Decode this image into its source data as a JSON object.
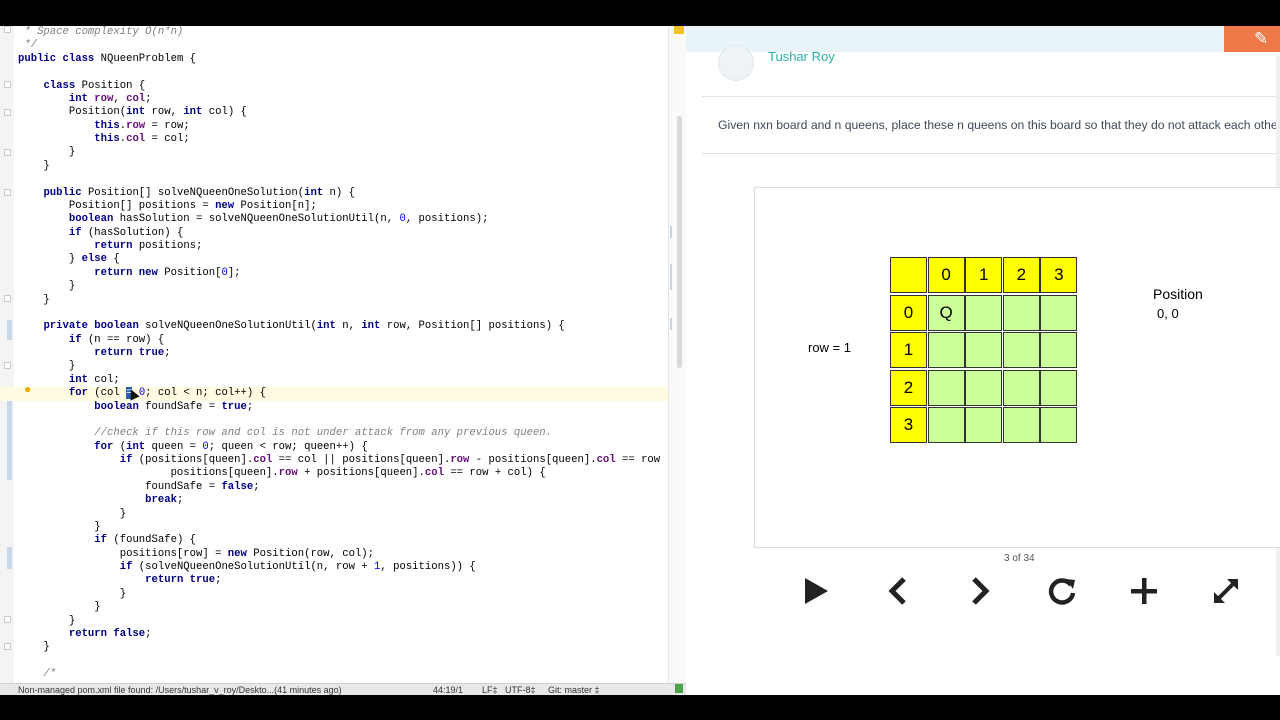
{
  "editor": {
    "lines": [
      [
        {
          "t": " * Space complexity O(n*n)",
          "c": "cmt"
        }
      ],
      [
        {
          "t": " */",
          "c": "cmt"
        }
      ],
      [
        {
          "t": "public class ",
          "c": "kw"
        },
        {
          "t": "NQueenProblem {"
        }
      ],
      [
        {
          "t": ""
        }
      ],
      [
        {
          "t": "    "
        },
        {
          "t": "class ",
          "c": "kw"
        },
        {
          "t": "Position {"
        }
      ],
      [
        {
          "t": "        "
        },
        {
          "t": "int ",
          "c": "kw"
        },
        {
          "t": "row",
          "c": "fld"
        },
        {
          "t": ", "
        },
        {
          "t": "col",
          "c": "fld"
        },
        {
          "t": ";"
        }
      ],
      [
        {
          "t": "        Position("
        },
        {
          "t": "int ",
          "c": "kw"
        },
        {
          "t": "row, "
        },
        {
          "t": "int ",
          "c": "kw"
        },
        {
          "t": "col) {"
        }
      ],
      [
        {
          "t": "            "
        },
        {
          "t": "this",
          "c": "kw"
        },
        {
          "t": "."
        },
        {
          "t": "row",
          "c": "fld"
        },
        {
          "t": " = row;"
        }
      ],
      [
        {
          "t": "            "
        },
        {
          "t": "this",
          "c": "kw"
        },
        {
          "t": "."
        },
        {
          "t": "col",
          "c": "fld"
        },
        {
          "t": " = col;"
        }
      ],
      [
        {
          "t": "        }"
        }
      ],
      [
        {
          "t": "    }"
        }
      ],
      [
        {
          "t": ""
        }
      ],
      [
        {
          "t": "    "
        },
        {
          "t": "public ",
          "c": "kw"
        },
        {
          "t": "Position[] solveNQueenOneSolution("
        },
        {
          "t": "int ",
          "c": "kw"
        },
        {
          "t": "n) {"
        }
      ],
      [
        {
          "t": "        Position[] positions = "
        },
        {
          "t": "new ",
          "c": "kw"
        },
        {
          "t": "Position[n];"
        }
      ],
      [
        {
          "t": "        "
        },
        {
          "t": "boolean ",
          "c": "kw"
        },
        {
          "t": "hasSolution = solveNQueenOneSolutionUtil(n, "
        },
        {
          "t": "0",
          "c": "num"
        },
        {
          "t": ", positions);"
        }
      ],
      [
        {
          "t": "        "
        },
        {
          "t": "if ",
          "c": "kw"
        },
        {
          "t": "(hasSolution) {"
        }
      ],
      [
        {
          "t": "            "
        },
        {
          "t": "return ",
          "c": "kw"
        },
        {
          "t": "positions;"
        }
      ],
      [
        {
          "t": "        } "
        },
        {
          "t": "else ",
          "c": "kw"
        },
        {
          "t": "{"
        }
      ],
      [
        {
          "t": "            "
        },
        {
          "t": "return new ",
          "c": "kw"
        },
        {
          "t": "Position["
        },
        {
          "t": "0",
          "c": "num"
        },
        {
          "t": "];"
        }
      ],
      [
        {
          "t": "        }"
        }
      ],
      [
        {
          "t": "    }"
        }
      ],
      [
        {
          "t": ""
        }
      ],
      [
        {
          "t": "    "
        },
        {
          "t": "private boolean ",
          "c": "kw"
        },
        {
          "t": "solveNQueenOneSolutionUtil("
        },
        {
          "t": "int ",
          "c": "kw"
        },
        {
          "t": "n, "
        },
        {
          "t": "int ",
          "c": "kw"
        },
        {
          "t": "row, Position[] positions) {"
        }
      ],
      [
        {
          "t": "        "
        },
        {
          "t": "if ",
          "c": "kw"
        },
        {
          "t": "(n == row) {"
        }
      ],
      [
        {
          "t": "            "
        },
        {
          "t": "return true",
          "c": "kw"
        },
        {
          "t": ";"
        }
      ],
      [
        {
          "t": "        }"
        }
      ],
      [
        {
          "t": "        "
        },
        {
          "t": "int ",
          "c": "kw"
        },
        {
          "t": "col;"
        }
      ],
      [
        {
          "t": "        "
        },
        {
          "t": "for ",
          "c": "kw"
        },
        {
          "t": "(col "
        },
        {
          "t": "=",
          "c": "caret"
        },
        {
          "t": " "
        },
        {
          "t": "0",
          "c": "num"
        },
        {
          "t": "; col < n; col++) {"
        }
      ],
      [
        {
          "t": "            "
        },
        {
          "t": "boolean ",
          "c": "kw"
        },
        {
          "t": "foundSafe = "
        },
        {
          "t": "true",
          "c": "kw"
        },
        {
          "t": ";"
        }
      ],
      [
        {
          "t": ""
        }
      ],
      [
        {
          "t": "            //check if this row and col is not under attack from any previous queen.",
          "c": "cmt"
        }
      ],
      [
        {
          "t": "            "
        },
        {
          "t": "for ",
          "c": "kw"
        },
        {
          "t": "("
        },
        {
          "t": "int ",
          "c": "kw"
        },
        {
          "t": "queen = "
        },
        {
          "t": "0",
          "c": "num"
        },
        {
          "t": "; queen < row; queen++) {"
        }
      ],
      [
        {
          "t": "                "
        },
        {
          "t": "if ",
          "c": "kw"
        },
        {
          "t": "(positions[queen]."
        },
        {
          "t": "col",
          "c": "fld"
        },
        {
          "t": " == col || positions[queen]."
        },
        {
          "t": "row",
          "c": "fld"
        },
        {
          "t": " - positions[queen]."
        },
        {
          "t": "col",
          "c": "fld"
        },
        {
          "t": " == row - col"
        }
      ],
      [
        {
          "t": "                        positions[queen]."
        },
        {
          "t": "row",
          "c": "fld"
        },
        {
          "t": " + positions[queen]."
        },
        {
          "t": "col",
          "c": "fld"
        },
        {
          "t": " == row + col) {"
        }
      ],
      [
        {
          "t": "                    foundSafe = "
        },
        {
          "t": "false",
          "c": "kw"
        },
        {
          "t": ";"
        }
      ],
      [
        {
          "t": "                    "
        },
        {
          "t": "break",
          "c": "kw"
        },
        {
          "t": ";"
        }
      ],
      [
        {
          "t": "                }"
        }
      ],
      [
        {
          "t": "            }"
        }
      ],
      [
        {
          "t": "            "
        },
        {
          "t": "if ",
          "c": "kw"
        },
        {
          "t": "(foundSafe) {"
        }
      ],
      [
        {
          "t": "                positions[row] = "
        },
        {
          "t": "new ",
          "c": "kw"
        },
        {
          "t": "Position(row, col);"
        }
      ],
      [
        {
          "t": "                "
        },
        {
          "t": "if ",
          "c": "kw"
        },
        {
          "t": "(solveNQueenOneSolutionUtil(n, row + "
        },
        {
          "t": "1",
          "c": "num"
        },
        {
          "t": ", positions)) {"
        }
      ],
      [
        {
          "t": "                    "
        },
        {
          "t": "return true",
          "c": "kw"
        },
        {
          "t": ";"
        }
      ],
      [
        {
          "t": "                }"
        }
      ],
      [
        {
          "t": "            }"
        }
      ],
      [
        {
          "t": "        }"
        }
      ],
      [
        {
          "t": "        "
        },
        {
          "t": "return false",
          "c": "kw"
        },
        {
          "t": ";"
        }
      ],
      [
        {
          "t": "    }"
        }
      ],
      [
        {
          "t": ""
        }
      ],
      [
        {
          "t": "    /*",
          "c": "cmt"
        }
      ]
    ],
    "current_line_index": 27,
    "status": {
      "message": "Non-managed pom.xml file found: /Users/tushar_v_roy/Deskto...(41 minutes ago)",
      "position": "44:19/1",
      "line_sep": "LF‡",
      "encoding": "UTF-8‡",
      "vcs": "Git: master ‡"
    }
  },
  "panel": {
    "author": "Tushar Roy",
    "problem": "Given nxn board and n queens, place these n queens on this board so that they do not attack each other.",
    "row_label": "row = 1",
    "position_title": "Position",
    "position_value": "0, 0",
    "slide_counter": "3 of 34",
    "board": {
      "col_headers": [
        "",
        "0",
        "1",
        "2",
        "3"
      ],
      "row_headers": [
        "0",
        "1",
        "2",
        "3"
      ],
      "cells": [
        [
          "Q",
          "",
          "",
          ""
        ],
        [
          "",
          "",
          "",
          ""
        ],
        [
          "",
          "",
          "",
          ""
        ],
        [
          "",
          "",
          "",
          ""
        ]
      ]
    },
    "colors": {
      "header_cell": "#ffff00",
      "board_cell": "#ccff99",
      "accent": "#2bb1a6",
      "edit_tab": "#ee7a4a"
    },
    "controls": [
      "play-icon",
      "previous-icon",
      "next-icon",
      "replay-icon",
      "add-icon",
      "fullscreen-icon"
    ]
  }
}
